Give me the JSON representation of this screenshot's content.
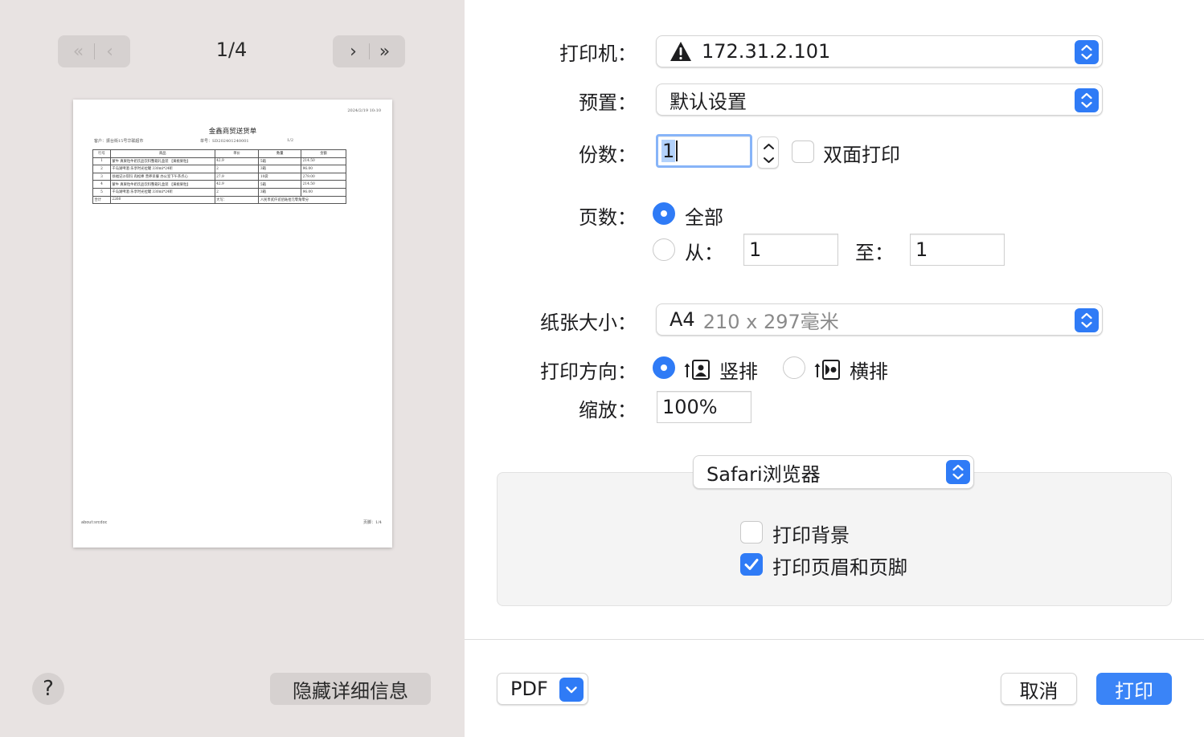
{
  "preview": {
    "page_indicator": "1/4",
    "nav_back_glyphs": [
      "«",
      "‹"
    ],
    "nav_forward_glyphs": [
      "›",
      "»"
    ],
    "document": {
      "timestamp": "2024/2/19 10:10",
      "title": "金鑫商贸送货单",
      "customer": "客户：振台街15号华联超市",
      "order_no": "单号：SD202401240001",
      "page": "1/2",
      "table_headers": [
        "行号",
        "商品",
        "单价",
        "数量",
        "金额"
      ],
      "table_rows": [
        [
          "1",
          "蒙牛 真果粒牛奶饮品饮料整箱礼盒装 【黄桃果粒】",
          "42.9",
          "5箱",
          "214.50"
        ],
        [
          "2",
          "千岛湖啤酒 乐享时光拉罐 330ml*24听",
          "2",
          "3箱",
          "96.00"
        ],
        [
          "3",
          "徐福记沙琪玛 肉松棒 营养早餐 办公室下午茶点心",
          "27.9",
          "10袋",
          "279.00"
        ],
        [
          "4",
          "蒙牛 真果粒牛奶饮品饮料整箱礼盒装 【黄桃果粒】",
          "42.9",
          "5箱",
          "214.50"
        ],
        [
          "5",
          "千岛湖啤酒 乐享时光拉罐 330ml*24听",
          "2",
          "3箱",
          "96.00"
        ]
      ],
      "total_row": [
        "合计",
        "2260",
        "大写：",
        "人民币贰仟贰佰陆拾元零角零分"
      ],
      "footer_left": "about:srcdoc",
      "footer_right": "页脚：1/4"
    },
    "help_label": "?",
    "hide_details_label": "隐藏详细信息"
  },
  "settings": {
    "printer": {
      "label": "打印机：",
      "value": "172.31.2.101"
    },
    "presets": {
      "label": "预置：",
      "value": "默认设置"
    },
    "copies": {
      "label": "份数：",
      "value": "1",
      "duplex_label": "双面打印"
    },
    "pages": {
      "label": "页数：",
      "all_label": "全部",
      "from_label": "从：",
      "from_value": "1",
      "to_label": "至：",
      "to_value": "1"
    },
    "paper_size": {
      "label": "纸张大小：",
      "value_main": "A4",
      "value_detail": "210 x 297毫米"
    },
    "orientation": {
      "label": "打印方向：",
      "portrait_label": "竖排",
      "landscape_label": "横排"
    },
    "scale": {
      "label": "缩放：",
      "value": "100%"
    },
    "app_section": {
      "value": "Safari浏览器",
      "print_backgrounds_label": "打印背景",
      "print_headers_footers_label": "打印页眉和页脚"
    }
  },
  "footer": {
    "pdf_label": "PDF",
    "cancel_label": "取消",
    "print_label": "打印"
  },
  "colors": {
    "accent": "#2f7bf6",
    "left_pane_bg": "#e8e3e2"
  }
}
